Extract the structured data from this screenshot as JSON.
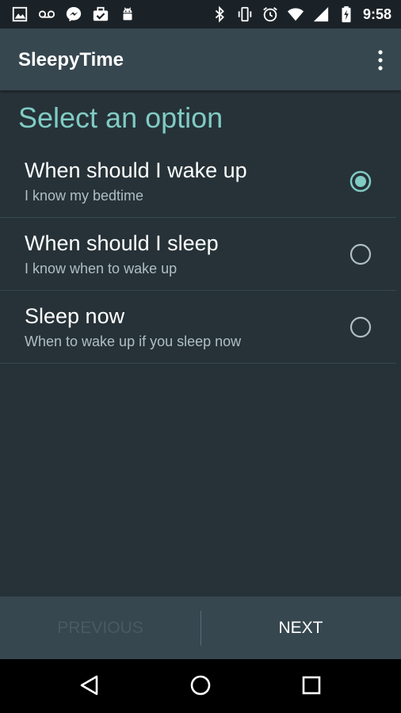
{
  "status_bar": {
    "time": "9:58",
    "left_icons": [
      "image-icon",
      "voicemail-icon",
      "messenger-icon",
      "briefcase-check-icon",
      "android-icon"
    ],
    "right_icons": [
      "bluetooth-icon",
      "vibrate-icon",
      "alarm-icon",
      "wifi-icon",
      "signal-icon",
      "battery-charging-icon"
    ]
  },
  "app_bar": {
    "title": "SleepyTime",
    "overflow_icon": "more-vert-icon"
  },
  "section": {
    "title": "Select an option"
  },
  "options": [
    {
      "title": "When should I wake up",
      "subtitle": "I know my bedtime",
      "selected": true
    },
    {
      "title": "When should I sleep",
      "subtitle": "I know when to wake up",
      "selected": false
    },
    {
      "title": "Sleep now",
      "subtitle": "When to wake up if you sleep now",
      "selected": false
    }
  ],
  "bottom_bar": {
    "previous_label": "PREVIOUS",
    "next_label": "NEXT"
  },
  "nav_bar": {
    "icons": [
      "back-icon",
      "home-icon",
      "recents-icon"
    ]
  },
  "colors": {
    "accent": "#80cbc4",
    "background": "#263238",
    "app_bar": "#37474f"
  }
}
